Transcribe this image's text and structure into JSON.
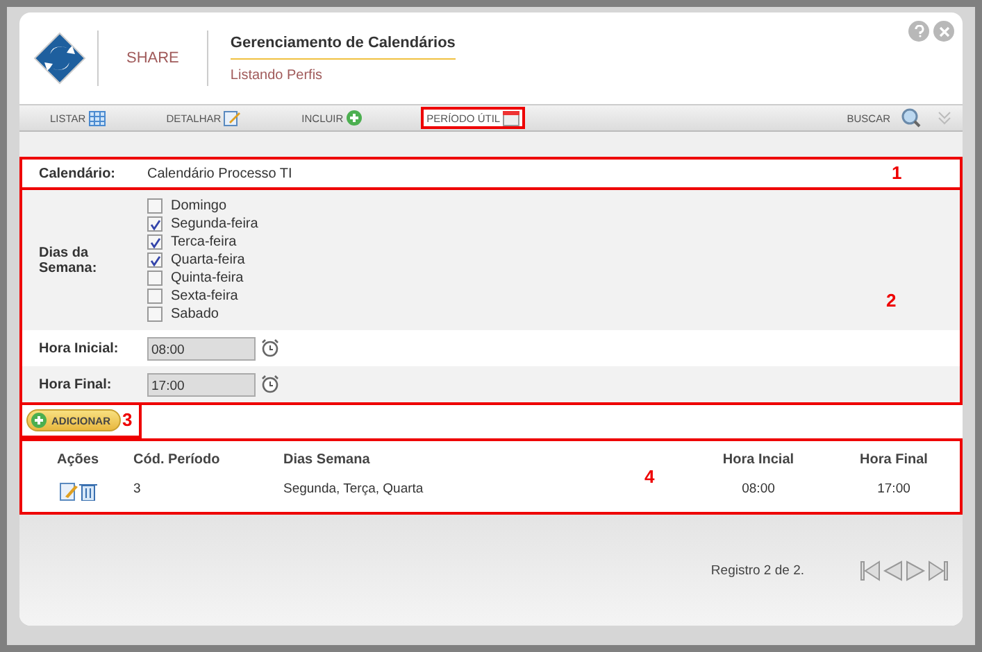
{
  "header": {
    "brand": "SHARE",
    "title": "Gerenciamento de Calendários",
    "subtitle": "Listando Perfis"
  },
  "toolbar": {
    "tabs": [
      {
        "label": "LISTAR",
        "selected": false
      },
      {
        "label": "DETALHAR",
        "selected": false
      },
      {
        "label": "INCLUIR",
        "selected": false
      },
      {
        "label": "PERÍODO ÚTIL",
        "selected": true
      }
    ],
    "search": "BUSCAR"
  },
  "calendar_section": {
    "callout": "1",
    "label": "Calendário:",
    "value": "Calendário Processo TI"
  },
  "period_section": {
    "callout": "2",
    "days_label": "Dias da Semana:",
    "days": [
      {
        "label": "Domingo",
        "checked": false
      },
      {
        "label": "Segunda-feira",
        "checked": true
      },
      {
        "label": "Terca-feira",
        "checked": true
      },
      {
        "label": "Quarta-feira",
        "checked": true
      },
      {
        "label": "Quinta-feira",
        "checked": false
      },
      {
        "label": "Sexta-feira",
        "checked": false
      },
      {
        "label": "Sabado",
        "checked": false
      }
    ],
    "times": [
      {
        "label": "Hora Inicial:",
        "value": "08:00"
      },
      {
        "label": "Hora Final:",
        "value": "17:00"
      }
    ]
  },
  "add_button": {
    "label": "ADICIONAR",
    "callout": "3"
  },
  "table": {
    "callout": "4",
    "columns": [
      "Ações",
      "Cód. Período",
      "Dias Semana",
      "Hora Incial",
      "Hora Final"
    ],
    "rows": [
      {
        "code": "3",
        "days": "Segunda, Terça, Quarta",
        "start": "08:00",
        "end": "17:00"
      }
    ]
  },
  "footer": {
    "records": "Registro 2 de 2."
  }
}
